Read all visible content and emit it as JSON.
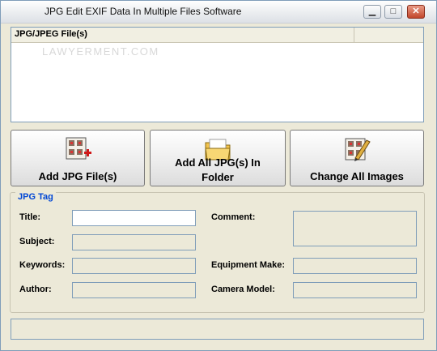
{
  "window": {
    "title": "JPG Edit EXIF Data In Multiple Files Software",
    "minimize_label": "▁",
    "maximize_label": "□",
    "close_label": "✕"
  },
  "file_list": {
    "column_header": "JPG/JPEG File(s)",
    "watermark": "LAWYERMENT.COM",
    "rows": []
  },
  "buttons": {
    "add_files": {
      "label": "Add JPG File(s)",
      "icon": "add-files-icon"
    },
    "add_folder": {
      "label_line1": "Add All JPG(s) In",
      "label_line2": "Folder",
      "icon": "folder-icon"
    },
    "change_all": {
      "label": "Change All Images",
      "icon": "edit-images-icon"
    }
  },
  "jpg_tag": {
    "group_label": "JPG Tag",
    "title": {
      "label": "Title:",
      "value": ""
    },
    "subject": {
      "label": "Subject:",
      "value": ""
    },
    "keywords": {
      "label": "Keywords:",
      "value": ""
    },
    "author": {
      "label": "Author:",
      "value": ""
    },
    "comment": {
      "label": "Comment:",
      "value": ""
    },
    "equipment_make": {
      "label": "Equipment Make:",
      "value": ""
    },
    "camera_model": {
      "label": "Camera Model:",
      "value": ""
    }
  },
  "status": {
    "text": ""
  }
}
